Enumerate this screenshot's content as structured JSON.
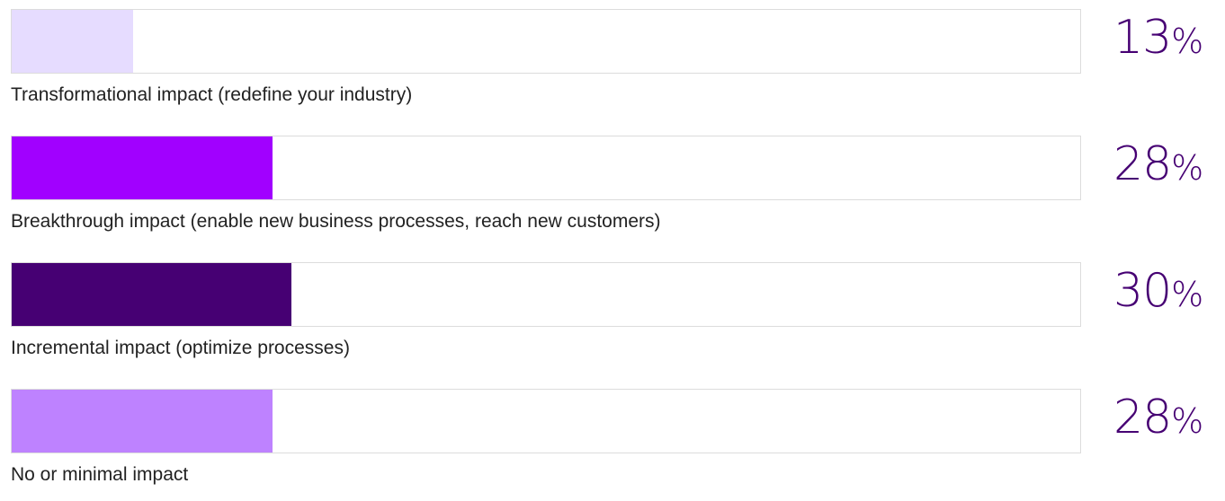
{
  "chart_data": {
    "type": "bar",
    "orientation": "horizontal",
    "xlim": [
      0,
      100
    ],
    "unit": "%",
    "categories": [
      "Transformational impact (redefine your industry)",
      "Breakthrough impact (enable new business processes, reach new customers)",
      "Incremental impact (optimize processes)",
      "No or minimal impact"
    ],
    "values": [
      13,
      28,
      30,
      28
    ],
    "value_labels": [
      "13",
      "28",
      "30",
      "28"
    ],
    "colors": [
      "#e6dcff",
      "#a100ff",
      "#460073",
      "#be82ff"
    ],
    "label_color": "#460073",
    "track_border_color": "#dcdcdc",
    "grid": false,
    "legend": "none"
  }
}
